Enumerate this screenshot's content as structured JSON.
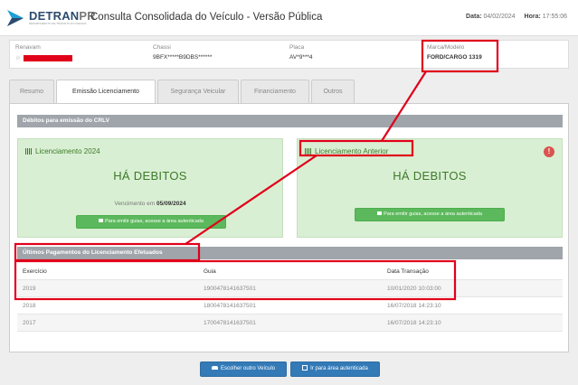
{
  "header": {
    "logo_main": "DETRAN",
    "logo_suffix": "PR",
    "logo_sub": "DEPARTAMENTO DE TRÂNSITO DO PARANÁ",
    "title": "Consulta Consolidada do Veículo - Versão Pública",
    "date_label": "Data:",
    "date_value": "04/02/2024",
    "time_label": "Hora:",
    "time_value": "17:55:06"
  },
  "vehicle": {
    "renavam_label": "Renavam",
    "renavam_value": "☆",
    "chassi_label": "Chassi",
    "chassi_value": "9BFX*****B9DBS******",
    "placa_label": "Placa",
    "placa_value": "AV*9***4",
    "marca_label": "Marca/Modelo",
    "marca_value": "FORD/CARGO 1319"
  },
  "tabs": [
    {
      "label": "Resumo"
    },
    {
      "label": "Emissão Licenciamento"
    },
    {
      "label": "Segurança Veicular"
    },
    {
      "label": "Financiamento"
    },
    {
      "label": "Outros"
    }
  ],
  "debitos": {
    "section_title": "Débitos para emissão do CRLV",
    "card_2024": {
      "title": "Licenciamento 2024",
      "status": "HÁ DEBITOS",
      "due_label": "Vencimento em",
      "due_date": "05/09/2024",
      "button_label": "Para emitir guias, acesse a área autenticada"
    },
    "card_anterior": {
      "title": "Licenciamento Anterior",
      "status": "HÁ DEBITOS",
      "button_label": "Para emitir guias, acesse a área autenticada",
      "warning_glyph": "!"
    }
  },
  "pagamentos": {
    "section_title": "Últimos Pagamentos do Licenciamento Efetuados",
    "columns": [
      "Exercício",
      "Guia",
      "Data Transação"
    ],
    "rows": [
      [
        "2019",
        "1900478141637501",
        "10/01/2020 10:03:00"
      ],
      [
        "2018",
        "1800478141637501",
        "16/07/2018 14:23:10"
      ],
      [
        "2017",
        "1700478141637501",
        "16/07/2018 14:23:10"
      ]
    ]
  },
  "footer": {
    "choose_vehicle": "Escolher outro Veículo",
    "go_auth": "Ir para área autenticada"
  },
  "colors": {
    "annotation": "#e0001a",
    "brand_blue": "#2d4b6e",
    "success": "#5cb85c",
    "primary": "#337ab7"
  }
}
